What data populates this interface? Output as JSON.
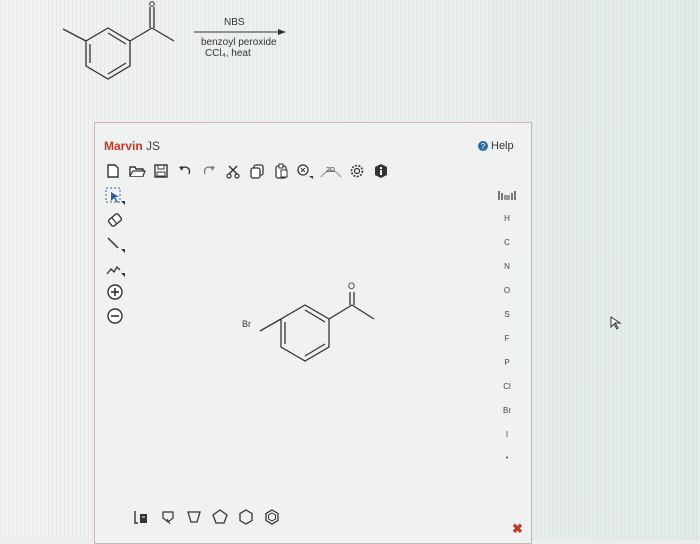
{
  "question": {
    "reagent_line1": "NBS",
    "reagent_line2": "benzoyl peroxide",
    "reagent_line3": "CCl₄, heat"
  },
  "marvin": {
    "title_brand": "Marvin",
    "title_suffix": " JS",
    "help_label": "Help"
  },
  "toolbar_top": [
    {
      "name": "new-document-icon"
    },
    {
      "name": "open-folder-icon"
    },
    {
      "name": "save-icon"
    },
    {
      "name": "undo-icon"
    },
    {
      "name": "redo-icon"
    },
    {
      "name": "cut-icon"
    },
    {
      "name": "copy-icon"
    },
    {
      "name": "paste-icon"
    },
    {
      "name": "zoom-icon"
    },
    {
      "name": "clean-2d-icon",
      "label": "2D"
    },
    {
      "name": "settings-icon"
    },
    {
      "name": "info-icon"
    }
  ],
  "toolbar_left": [
    {
      "name": "select-tool-icon"
    },
    {
      "name": "erase-tool-icon"
    },
    {
      "name": "bond-tool-icon"
    },
    {
      "name": "chain-tool-icon"
    },
    {
      "name": "positive-charge-icon"
    },
    {
      "name": "negative-charge-icon"
    }
  ],
  "periodic_elements": [
    "H",
    "C",
    "N",
    "O",
    "S",
    "F",
    "P",
    "Cl",
    "Br",
    "I",
    "•"
  ],
  "canvas": {
    "atom_br": "Br",
    "atom_o": "O"
  },
  "toolbar_bottom": [
    {
      "name": "template-selector-icon"
    },
    {
      "name": "benzene-template-icon"
    },
    {
      "name": "cyclopentane-template-icon"
    },
    {
      "name": "cyclohexane-template-icon"
    },
    {
      "name": "hexagon-template-icon"
    },
    {
      "name": "cyclohexene-template-icon"
    }
  ],
  "close_label": "✖"
}
